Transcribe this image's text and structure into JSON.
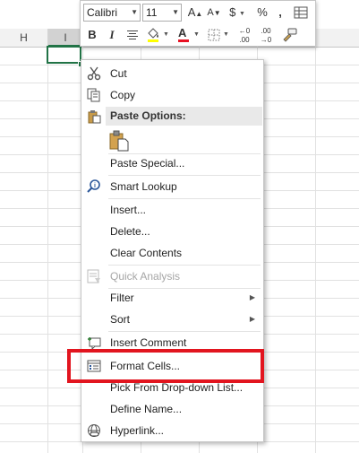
{
  "spreadsheet": {
    "column_headers": [
      "H",
      "I"
    ]
  },
  "mini_toolbar": {
    "font_name": "Calibri",
    "font_size": "11",
    "increase_font_label": "A",
    "decrease_font_label": "A",
    "currency_label": "$",
    "percent_label": "%",
    "comma_label": ",",
    "bold_label": "B",
    "italic_label": "I",
    "font_color_label": "A",
    "increase_decimal_label": ".00",
    "decrease_decimal_label": ".00",
    "accent_fill_color": "#ffff00",
    "accent_font_color": "#e81123"
  },
  "context_menu": {
    "items": [
      {
        "label": "Cut",
        "icon": "scissors-icon"
      },
      {
        "label": "Copy",
        "icon": "copy-icon"
      },
      {
        "label": "Paste Options:",
        "icon": "paste-icon"
      },
      {
        "label": "Paste Special...",
        "icon": ""
      },
      {
        "label": "Smart Lookup",
        "icon": "smart-lookup-icon"
      },
      {
        "label": "Insert...",
        "icon": ""
      },
      {
        "label": "Delete...",
        "icon": ""
      },
      {
        "label": "Clear Contents",
        "icon": ""
      },
      {
        "label": "Quick Analysis",
        "icon": "quick-analysis-icon",
        "disabled": true
      },
      {
        "label": "Filter",
        "icon": "",
        "submenu": true
      },
      {
        "label": "Sort",
        "icon": "",
        "submenu": true
      },
      {
        "label": "Insert Comment",
        "icon": "insert-comment-icon"
      },
      {
        "label": "Format Cells...",
        "icon": "format-cells-icon"
      },
      {
        "label": "Pick From Drop-down List...",
        "icon": ""
      },
      {
        "label": "Define Name...",
        "icon": ""
      },
      {
        "label": "Hyperlink...",
        "icon": "hyperlink-icon"
      }
    ]
  },
  "highlight": {
    "target": "Format Cells...",
    "color": "#e2151f"
  }
}
